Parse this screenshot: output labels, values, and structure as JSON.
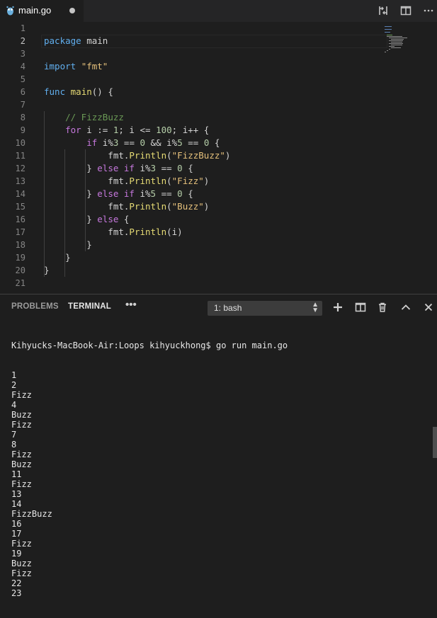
{
  "tab": {
    "title": "main.go",
    "icon": "go-gopher-icon",
    "modified": true
  },
  "toolbar_icons": [
    "git-compare-icon",
    "split-editor-icon",
    "more-actions-icon"
  ],
  "editor": {
    "active_line": 2,
    "line_numbers": [
      "1",
      "2",
      "3",
      "4",
      "5",
      "6",
      "7",
      "8",
      "9",
      "10",
      "11",
      "12",
      "13",
      "14",
      "15",
      "16",
      "17",
      "18",
      "19",
      "20",
      "21"
    ],
    "lines": [
      [],
      [
        {
          "t": "package",
          "c": "kb"
        },
        {
          "t": " main",
          "c": "p"
        }
      ],
      [],
      [
        {
          "t": "import",
          "c": "kb"
        },
        {
          "t": " ",
          "c": "p"
        },
        {
          "t": "\"fmt\"",
          "c": "s"
        }
      ],
      [],
      [
        {
          "t": "func",
          "c": "kb"
        },
        {
          "t": " ",
          "c": "p"
        },
        {
          "t": "main",
          "c": "fn"
        },
        {
          "t": "() {",
          "c": "p"
        }
      ],
      [],
      [
        {
          "t": "    ",
          "c": "p"
        },
        {
          "t": "// FizzBuzz",
          "c": "c"
        }
      ],
      [
        {
          "t": "    ",
          "c": "p"
        },
        {
          "t": "for",
          "c": "k"
        },
        {
          "t": " i := ",
          "c": "p"
        },
        {
          "t": "1",
          "c": "num"
        },
        {
          "t": "; i <= ",
          "c": "p"
        },
        {
          "t": "100",
          "c": "num"
        },
        {
          "t": "; i++ {",
          "c": "p"
        }
      ],
      [
        {
          "t": "        ",
          "c": "p"
        },
        {
          "t": "if",
          "c": "k"
        },
        {
          "t": " i%",
          "c": "p"
        },
        {
          "t": "3",
          "c": "num"
        },
        {
          "t": " == ",
          "c": "p"
        },
        {
          "t": "0",
          "c": "num"
        },
        {
          "t": " && i%",
          "c": "p"
        },
        {
          "t": "5",
          "c": "num"
        },
        {
          "t": " == ",
          "c": "p"
        },
        {
          "t": "0",
          "c": "num"
        },
        {
          "t": " {",
          "c": "p"
        }
      ],
      [
        {
          "t": "            fmt.",
          "c": "p"
        },
        {
          "t": "Println",
          "c": "fn"
        },
        {
          "t": "(",
          "c": "p"
        },
        {
          "t": "\"FizzBuzz\"",
          "c": "s"
        },
        {
          "t": ")",
          "c": "p"
        }
      ],
      [
        {
          "t": "        } ",
          "c": "p"
        },
        {
          "t": "else if",
          "c": "k"
        },
        {
          "t": " i%",
          "c": "p"
        },
        {
          "t": "3",
          "c": "num"
        },
        {
          "t": " == ",
          "c": "p"
        },
        {
          "t": "0",
          "c": "num"
        },
        {
          "t": " {",
          "c": "p"
        }
      ],
      [
        {
          "t": "            fmt.",
          "c": "p"
        },
        {
          "t": "Println",
          "c": "fn"
        },
        {
          "t": "(",
          "c": "p"
        },
        {
          "t": "\"Fizz\"",
          "c": "s"
        },
        {
          "t": ")",
          "c": "p"
        }
      ],
      [
        {
          "t": "        } ",
          "c": "p"
        },
        {
          "t": "else if",
          "c": "k"
        },
        {
          "t": " i%",
          "c": "p"
        },
        {
          "t": "5",
          "c": "num"
        },
        {
          "t": " == ",
          "c": "p"
        },
        {
          "t": "0",
          "c": "num"
        },
        {
          "t": " {",
          "c": "p"
        }
      ],
      [
        {
          "t": "            fmt.",
          "c": "p"
        },
        {
          "t": "Println",
          "c": "fn"
        },
        {
          "t": "(",
          "c": "p"
        },
        {
          "t": "\"Buzz\"",
          "c": "s"
        },
        {
          "t": ")",
          "c": "p"
        }
      ],
      [
        {
          "t": "        } ",
          "c": "p"
        },
        {
          "t": "else",
          "c": "k"
        },
        {
          "t": " {",
          "c": "p"
        }
      ],
      [
        {
          "t": "            fmt.",
          "c": "p"
        },
        {
          "t": "Println",
          "c": "fn"
        },
        {
          "t": "(i)",
          "c": "p"
        }
      ],
      [
        {
          "t": "        }",
          "c": "p"
        }
      ],
      [
        {
          "t": "    }",
          "c": "p"
        }
      ],
      [
        {
          "t": "}",
          "c": "p"
        }
      ],
      []
    ]
  },
  "panel": {
    "tabs": [
      "PROBLEMS",
      "TERMINAL"
    ],
    "active_tab": "TERMINAL",
    "more_label": "•••",
    "terminal_select": "1: bash",
    "icons": [
      "add-terminal-icon",
      "split-terminal-icon",
      "trash-icon",
      "maximize-panel-icon",
      "close-panel-icon"
    ]
  },
  "terminal": {
    "prompt": "Kihyucks-MacBook-Air:Loops kihyuckhong$ go run main.go",
    "output": [
      "1",
      "2",
      "Fizz",
      "4",
      "Buzz",
      "Fizz",
      "7",
      "8",
      "Fizz",
      "Buzz",
      "11",
      "Fizz",
      "13",
      "14",
      "FizzBuzz",
      "16",
      "17",
      "Fizz",
      "19",
      "Buzz",
      "Fizz",
      "22",
      "23"
    ]
  },
  "colors": {
    "editor_bg": "#1e1e1e",
    "tabbar_bg": "#252526",
    "keyword_purple": "#c678dd",
    "keyword_blue": "#61afef",
    "string": "#e5c07b",
    "comment": "#6a9955",
    "number": "#b5cea8"
  }
}
